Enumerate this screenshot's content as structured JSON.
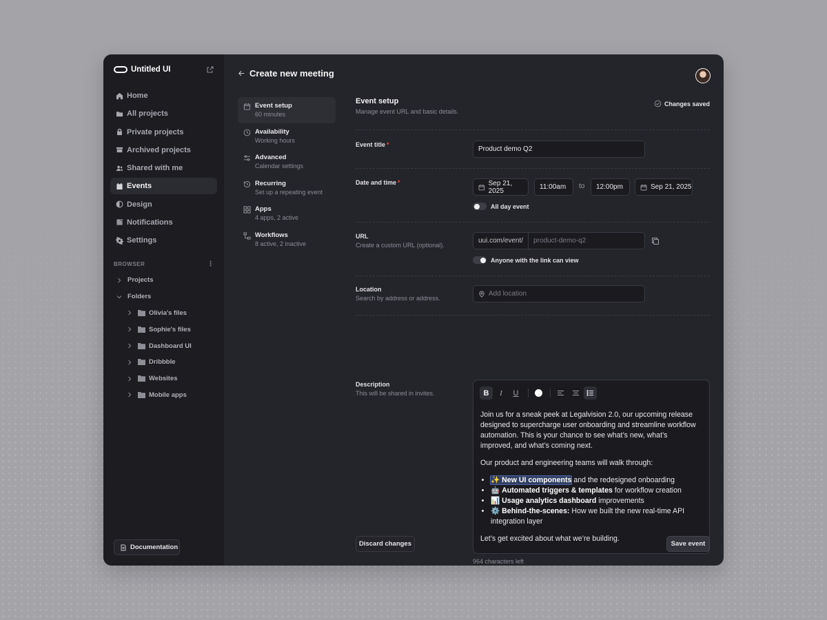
{
  "sidebar": {
    "brand": "Untitled UI",
    "items": [
      {
        "label": "Home",
        "icon": "home-icon"
      },
      {
        "label": "All projects",
        "icon": "folder-icon"
      },
      {
        "label": "Private projects",
        "icon": "lock-icon"
      },
      {
        "label": "Archived projects",
        "icon": "archive-icon"
      },
      {
        "label": "Shared with me",
        "icon": "users-icon"
      },
      {
        "label": "Events",
        "icon": "calendar-icon",
        "active": true
      },
      {
        "label": "Design",
        "icon": "contrast-icon"
      },
      {
        "label": "Notifications",
        "icon": "bell-icon"
      },
      {
        "label": "Settings",
        "icon": "gear-icon"
      }
    ],
    "browser_label": "BROWSER",
    "tree": {
      "projects": "Projects",
      "folders": "Folders",
      "children": [
        "Olivia's files",
        "Sophie's files",
        "Dashboard UI",
        "Dribbble",
        "Websites",
        "Mobile apps"
      ]
    },
    "documentation": "Documentation"
  },
  "header": {
    "title": "Create new meeting"
  },
  "steps": [
    {
      "title": "Event setup",
      "sub": "60 minutes",
      "active": true,
      "icon": "calendar-icon"
    },
    {
      "title": "Availability",
      "sub": "Working hours",
      "icon": "clock-icon"
    },
    {
      "title": "Advanced",
      "sub": "Calendar settings",
      "icon": "sliders-icon"
    },
    {
      "title": "Recurring",
      "sub": "Set up a repeating event",
      "icon": "history-icon"
    },
    {
      "title": "Apps",
      "sub": "4 apps, 2 active",
      "icon": "grid-icon"
    },
    {
      "title": "Workflows",
      "sub": "8 active, 2 inactive",
      "icon": "workflow-icon"
    }
  ],
  "form": {
    "title": "Event setup",
    "subtitle": "Manage event URL and basic details.",
    "saved_status": "Changes saved",
    "event_title": {
      "label": "Event title",
      "required": "*",
      "value": "Product demo Q2"
    },
    "date_time": {
      "label": "Date and time",
      "required": "*",
      "start_date": "Sep 21, 2025",
      "start_time": "11:00am",
      "to": "to",
      "end_time": "12:00pm",
      "end_date": "Sep 21, 2025",
      "all_day_label": "All day event",
      "all_day_on": false
    },
    "url": {
      "label": "URL",
      "sub": "Create a custom URL (optional).",
      "prefix": "uui.com/event/",
      "placeholder": "product-demo-q2",
      "public_label": "Anyone with the link can view",
      "public_on": true
    },
    "location": {
      "label": "Location",
      "sub": "Search by address or address.",
      "placeholder": "Add location"
    },
    "description": {
      "label": "Description",
      "sub": "This will be shared in invites.",
      "p1": "Join us for a sneak peek at Legalvision 2.0, our upcoming release designed to supercharge user onboarding and streamline workflow automation. This is your chance to see what’s new, what’s improved, and what’s coming next.",
      "p2": "Our product and engineering teams will walk through:",
      "bullets": [
        {
          "emoji": "✨",
          "bold": "New UI components",
          "rest": " and the redesigned onboarding"
        },
        {
          "emoji": "🤖",
          "bold": "Automated triggers & templates",
          "rest": " for workflow creation"
        },
        {
          "emoji": "📊",
          "bold": "Usage analytics dashboard",
          "rest": " improvements"
        },
        {
          "emoji": "⚙️",
          "bold": "Behind-the-scenes:",
          "rest": " How we built the new real-time API integration layer"
        }
      ],
      "p3": "Let’s get excited about what we’re building.",
      "chars_left": "964 characters left"
    },
    "discard": "Discard changes",
    "save": "Save event"
  }
}
